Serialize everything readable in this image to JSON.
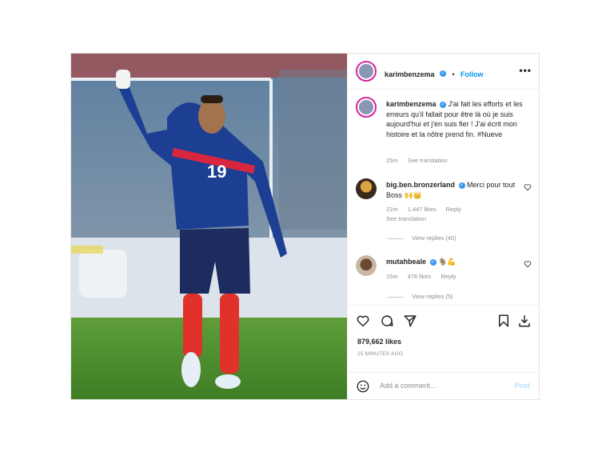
{
  "header": {
    "username": "karimbenzema",
    "separator": "•",
    "follow_label": "Follow",
    "more_label": "•••"
  },
  "caption": {
    "username": "karimbenzema",
    "text": "J'ai fait les efforts et les erreurs qu'il fallait pour être là où je suis aujourd'hui et j'en suis fier ! J'ai écrit mon histoire et la nôtre prend fin. #Nueve",
    "time": "25m",
    "see_translation": "See translation"
  },
  "comments": [
    {
      "username": "big.ben.bronzerland",
      "text": "Merci pour tout Boss 🙌👑",
      "time": "22m",
      "likes": "1,447 likes",
      "reply": "Reply",
      "see_translation": "See translation",
      "view_replies": "View replies (40)"
    },
    {
      "username": "mutahbeale",
      "text": "🐐💪",
      "time": "15m",
      "likes": "476 likes",
      "reply": "Reply",
      "view_replies": "View replies (5)"
    }
  ],
  "stats": {
    "likes": "879,662 likes",
    "posted": "25 MINUTES AGO"
  },
  "composer": {
    "placeholder": "Add a comment...",
    "post_label": "Post"
  },
  "photo": {
    "jersey_number": "19"
  },
  "icons": [
    "heart-icon",
    "comment-icon",
    "share-icon",
    "bookmark-icon",
    "insights-icon",
    "emoji-icon",
    "verified-icon",
    "more-icon"
  ],
  "colors": {
    "accent": "#0095f6",
    "verified": "#3897f0",
    "muted": "#8e8e8e",
    "jersey": "#1c3f94"
  }
}
